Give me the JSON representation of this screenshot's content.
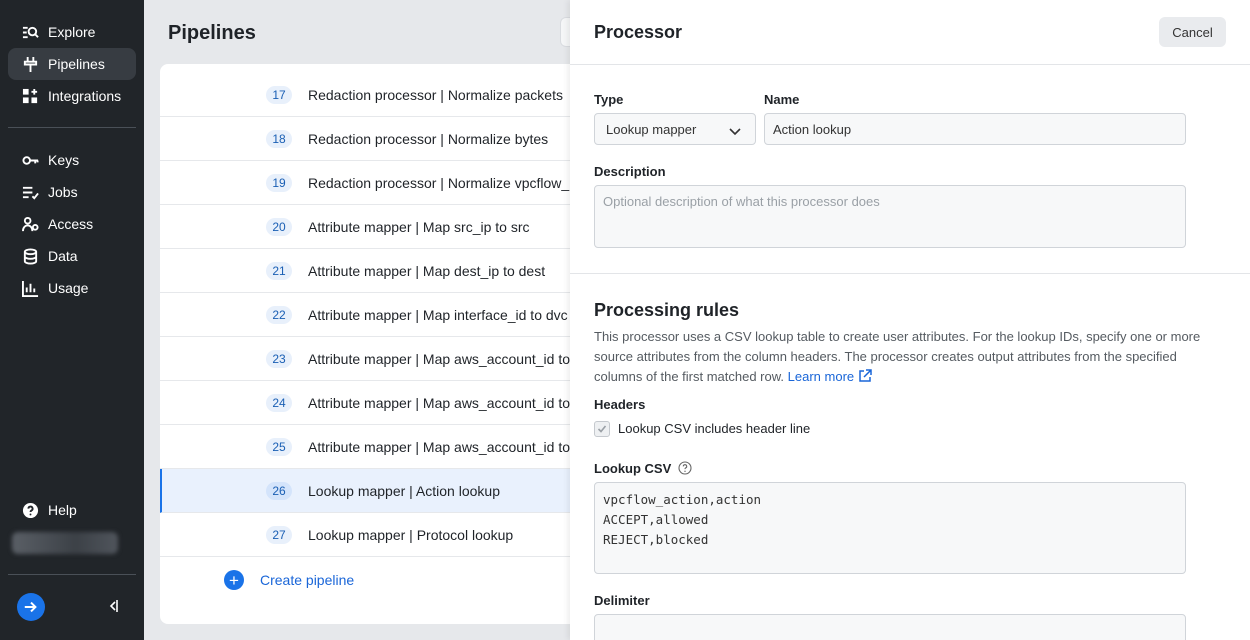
{
  "sidebar": {
    "items": [
      {
        "label": "Explore",
        "icon": "explore-icon"
      },
      {
        "label": "Pipelines",
        "icon": "pipelines-icon",
        "active": true
      },
      {
        "label": "Integrations",
        "icon": "integrations-icon"
      },
      {
        "label": "Keys",
        "icon": "key-icon"
      },
      {
        "label": "Jobs",
        "icon": "jobs-icon"
      },
      {
        "label": "Access",
        "icon": "access-icon"
      },
      {
        "label": "Data",
        "icon": "database-icon"
      },
      {
        "label": "Usage",
        "icon": "bar-chart-icon"
      }
    ],
    "help_label": "Help"
  },
  "pipelines": {
    "title": "Pipelines",
    "rows": [
      {
        "num": "17",
        "text": "Redaction processor  |  Normalize packets"
      },
      {
        "num": "18",
        "text": "Redaction processor  |  Normalize bytes"
      },
      {
        "num": "19",
        "text": "Redaction processor  |  Normalize vpcflow_"
      },
      {
        "num": "20",
        "text": "Attribute mapper  |  Map src_ip to src"
      },
      {
        "num": "21",
        "text": "Attribute mapper  |  Map dest_ip to dest"
      },
      {
        "num": "22",
        "text": "Attribute mapper  |  Map interface_id to dvc"
      },
      {
        "num": "23",
        "text": "Attribute mapper  |  Map aws_account_id to"
      },
      {
        "num": "24",
        "text": "Attribute mapper  |  Map aws_account_id to"
      },
      {
        "num": "25",
        "text": "Attribute mapper  |  Map aws_account_id to"
      },
      {
        "num": "26",
        "text": "Lookup mapper  |  Action lookup",
        "selected": true
      },
      {
        "num": "27",
        "text": "Lookup mapper  |  Protocol lookup"
      }
    ],
    "create_label": "Create pipeline"
  },
  "processor": {
    "title": "Processor",
    "cancel_label": "Cancel",
    "type_label": "Type",
    "type_value": "Lookup mapper",
    "name_label": "Name",
    "name_value": "Action lookup",
    "description_label": "Description",
    "description_placeholder": "Optional description of what this processor does",
    "rules_title": "Processing rules",
    "rules_desc": "This processor uses a CSV lookup table to create user attributes. For the lookup IDs, specify one or more source attributes from the column headers. The processor creates output attributes from the specified columns of the first matched row.",
    "learn_more": "Learn more",
    "headers_label": "Headers",
    "header_checkbox_label": "Lookup CSV includes header line",
    "header_checked": true,
    "lookup_csv_label": "Lookup CSV",
    "csv_lines": [
      "vpcflow_action,action",
      "ACCEPT,allowed",
      "REJECT,blocked"
    ],
    "delimiter_label": "Delimiter"
  },
  "colors": {
    "sidebar_bg": "#212529",
    "accent": "#1a73e8",
    "selected_row_bg": "#e9f1fd"
  }
}
